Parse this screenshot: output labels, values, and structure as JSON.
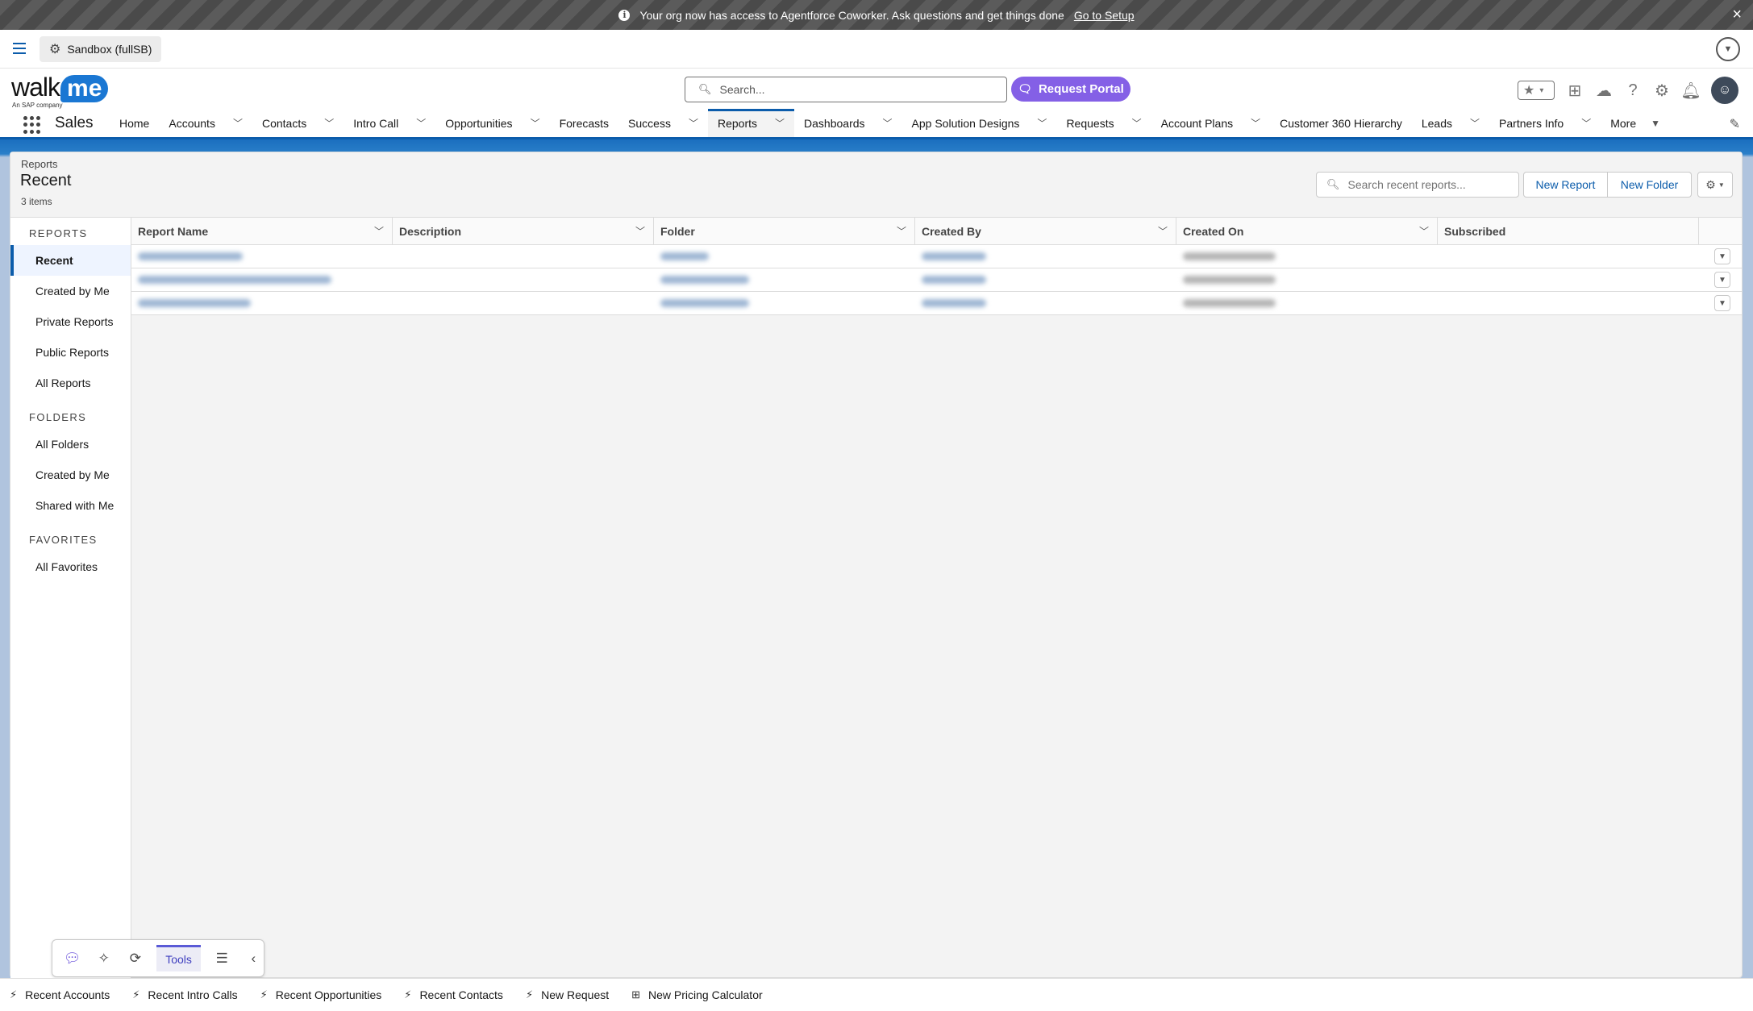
{
  "banner": {
    "message": "Your org now has access to Agentforce Coworker. Ask questions and get things done",
    "link": "Go to Setup"
  },
  "sandbox": {
    "label": "Sandbox (fullSB)"
  },
  "header": {
    "logo_word": "walk",
    "logo_me": "me",
    "logo_sub": "An SAP company",
    "search_placeholder": "Search...",
    "request_portal": "Request Portal"
  },
  "nav": {
    "app_name": "Sales",
    "items": [
      {
        "label": "Home"
      },
      {
        "label": "Accounts"
      },
      {
        "label": "Contacts"
      },
      {
        "label": "Intro Call"
      },
      {
        "label": "Opportunities"
      },
      {
        "label": "Forecasts"
      },
      {
        "label": "Success"
      },
      {
        "label": "Reports"
      },
      {
        "label": "Dashboards"
      },
      {
        "label": "App Solution Designs"
      },
      {
        "label": "Requests"
      },
      {
        "label": "Account Plans"
      },
      {
        "label": "Customer 360 Hierarchy"
      },
      {
        "label": "Leads"
      },
      {
        "label": "Partners Info"
      },
      {
        "label": "More"
      }
    ]
  },
  "page": {
    "breadcrumb": "Reports",
    "title": "Recent",
    "count": "3 items",
    "search_placeholder": "Search recent reports...",
    "new_report": "New Report",
    "new_folder": "New Folder"
  },
  "sidebar": {
    "reports_heading": "REPORTS",
    "reports": [
      "Recent",
      "Created by Me",
      "Private Reports",
      "Public Reports",
      "All Reports"
    ],
    "folders_heading": "FOLDERS",
    "folders": [
      "All Folders",
      "Created by Me",
      "Shared with Me"
    ],
    "favorites_heading": "FAVORITES",
    "favorites": [
      "All Favorites"
    ]
  },
  "table": {
    "columns": [
      "Report Name",
      "Description",
      "Folder",
      "Created By",
      "Created On",
      "Subscribed"
    ]
  },
  "tools": {
    "tab_label": "Tools"
  },
  "utility": {
    "items": [
      "Recent Accounts",
      "Recent Intro Calls",
      "Recent Opportunities",
      "Recent Contacts",
      "New Request",
      "New Pricing Calculator"
    ]
  },
  "colors": {
    "brand_blue": "#0b5cab",
    "request_portal_purple": "#8460e6"
  }
}
